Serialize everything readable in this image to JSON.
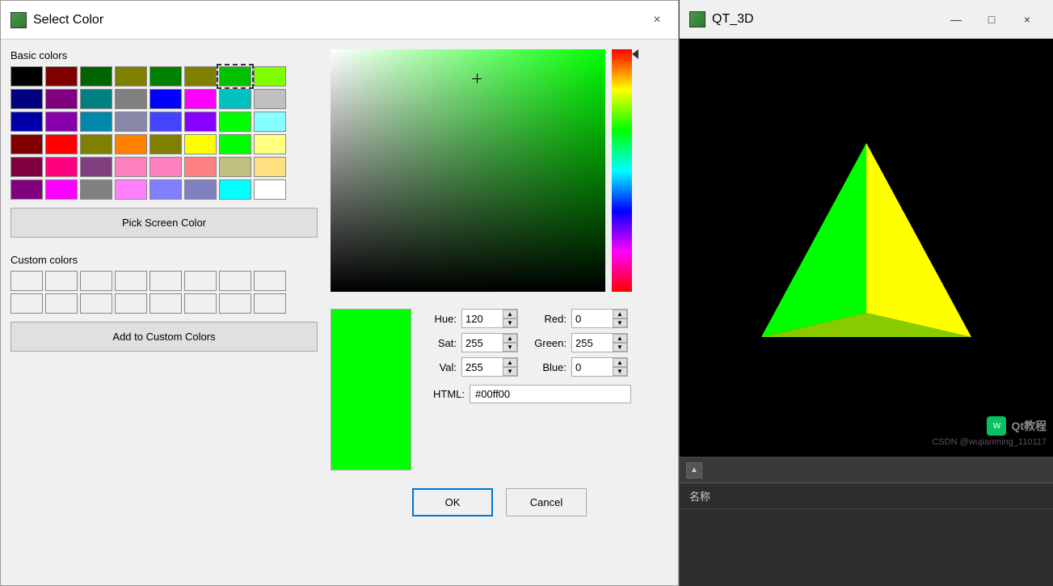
{
  "dialog": {
    "title": "Select Color",
    "icon_label": "color-icon",
    "close_label": "×",
    "sections": {
      "basic_colors_label": "Basic colors",
      "custom_colors_label": "Custom colors"
    },
    "buttons": {
      "pick_screen": "Pick Screen Color",
      "add_custom": "Add to Custom Colors",
      "ok": "OK",
      "cancel": "Cancel"
    },
    "color_values": {
      "hue_label": "Hue:",
      "hue_value": "120",
      "sat_label": "Sat:",
      "sat_value": "255",
      "val_label": "Val:",
      "val_value": "255",
      "red_label": "Red:",
      "red_value": "0",
      "green_label": "Green:",
      "green_value": "255",
      "blue_label": "Blue:",
      "blue_value": "0",
      "html_label": "HTML:",
      "html_value": "#00ff00"
    },
    "basic_colors": [
      "#000000",
      "#800000",
      "#006400",
      "#808000",
      "#008000",
      "#808000",
      "#00c000",
      "#80ff00",
      "#000080",
      "#800080",
      "#008080",
      "#808080",
      "#0000ff",
      "#ff00ff",
      "#00c0c0",
      "#c0c0c0",
      "#0000aa",
      "#8800aa",
      "#0088aa",
      "#8888aa",
      "#0000ff",
      "#8800ff",
      "#00ff00",
      "#88ffff",
      "#800000",
      "#ff0000",
      "#808000",
      "#ff8000",
      "#808000",
      "#ffff00",
      "#00ff00",
      "#ffff80",
      "#800040",
      "#ff0080",
      "#804080",
      "#ff80c0",
      "#ff80c0",
      "#ff8080",
      "#c0c080",
      "#ffe080",
      "#800080",
      "#ff00ff",
      "#808080",
      "#ff80ff",
      "#8080ff",
      "#8080c0",
      "#00ffff",
      "#ffffff"
    ],
    "selected_basic_color_index": 10
  },
  "qt3d": {
    "title": "QT_3D",
    "icon_label": "qt3d-icon",
    "min_label": "—",
    "restore_label": "□",
    "close_label": "×",
    "table_header": "名称",
    "watermark": "Qt教程",
    "watermark_sub": "CSDN @wujianming_110117"
  }
}
